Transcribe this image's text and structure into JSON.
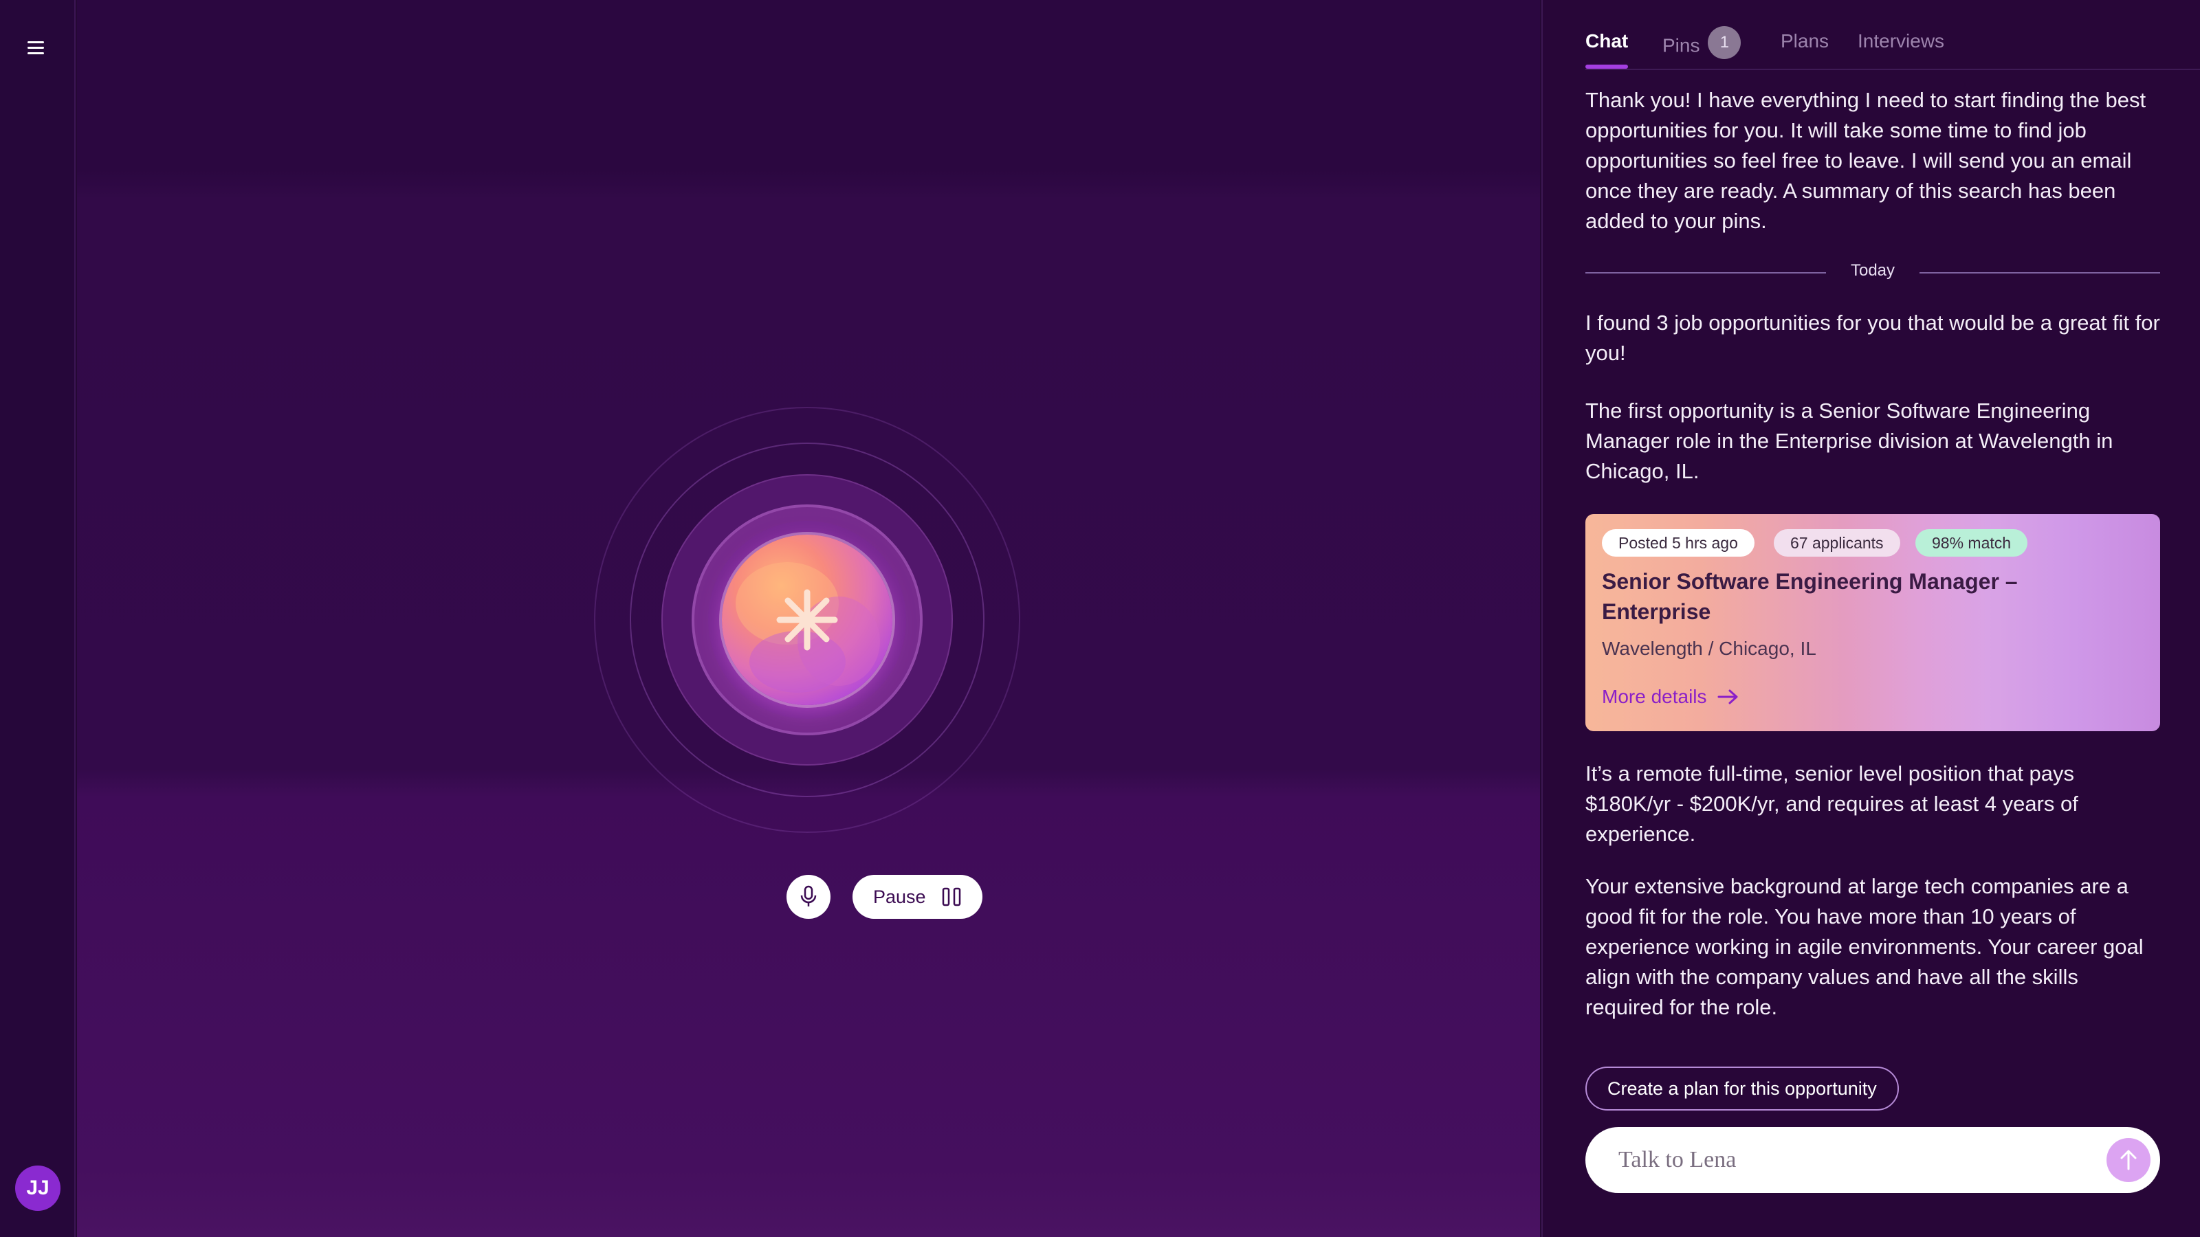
{
  "nav": {
    "menu_icon": "hamburger-menu-icon",
    "avatar_initials": "JJ"
  },
  "voice": {
    "orb_icon": "asterisk-icon",
    "mic_icon": "microphone-icon",
    "pause_label": "Pause",
    "pause_icon": "pause-icon"
  },
  "tabs": [
    {
      "label": "Chat",
      "active": true
    },
    {
      "label": "Pins",
      "badge": "1"
    },
    {
      "label": "Plans"
    },
    {
      "label": "Interviews"
    }
  ],
  "chat": {
    "message_1": "Thank you! I have everything I need to start finding the best opportunities for you. It will take some time to find job opportunities so feel free to leave. I will send you an email once they are ready. A summary of this search has been added to your pins.",
    "divider": "Today",
    "message_2": "I found 3 job opportunities for you that would be a great fit for you!",
    "message_3": "The first opportunity is a Senior Software Engineering Manager role in the Enterprise division at Wavelength in Chicago, IL.",
    "job_card": {
      "posted": "Posted 5 hrs ago",
      "applicants": "67 applicants",
      "match": "98% match",
      "title": "Senior Software Engineering Manager – Enterprise",
      "subtitle": "Wavelength / Chicago, IL",
      "link_label": "More details",
      "link_icon": "arrow-right-icon"
    },
    "message_4": "It’s a remote full-time, senior level position that pays $180K/yr - $200K/yr, and requires at least 4 years of experience.",
    "message_5": "Your extensive background at large tech companies are a good fit for the role. You have more than 10 years of experience working in agile environments. Your career goal align with the company values and have all the skills required for the role.",
    "plan_button": "Create a plan for this opportunity",
    "input_placeholder": "Talk to Lena",
    "send_icon": "arrow-up-icon"
  },
  "colors": {
    "background": "#2b0740",
    "accent": "#a43fe0",
    "match_chip": "#b9f0d8"
  }
}
